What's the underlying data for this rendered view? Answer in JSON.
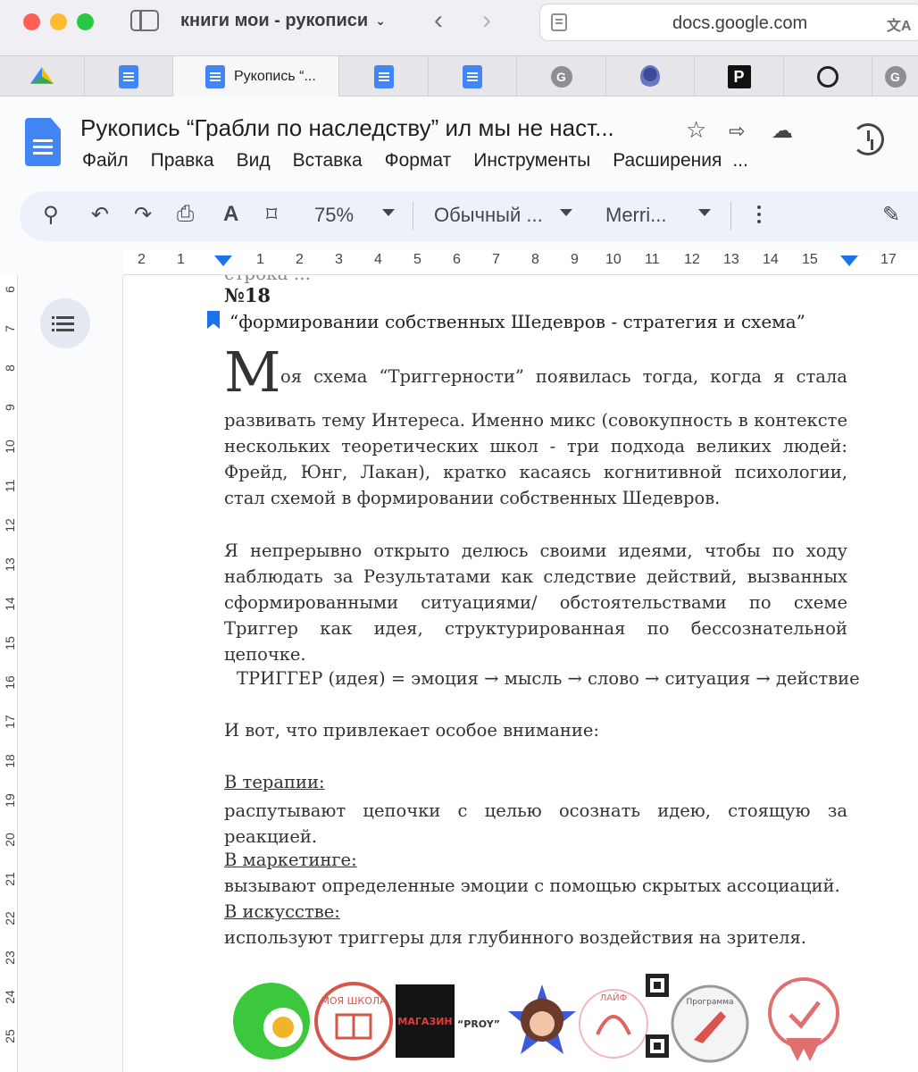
{
  "browser": {
    "window_title": "книги мои - рукописи",
    "url": "docs.google.com",
    "tabs": [
      {
        "icon": "google-drive-icon"
      },
      {
        "icon": "google-docs-icon"
      },
      {
        "icon": "google-docs-icon",
        "label": "Рукопись “...",
        "active": true
      },
      {
        "icon": "google-docs-icon"
      },
      {
        "icon": "google-docs-icon"
      },
      {
        "icon": "grammarly-icon",
        "letter": "G"
      },
      {
        "icon": "lion-icon"
      },
      {
        "icon": "p-icon",
        "letter": "P"
      },
      {
        "icon": "openai-icon"
      },
      {
        "icon": "grammarly-icon",
        "letter": "G"
      }
    ]
  },
  "docs": {
    "title": "Рукопись “Грабли по наследству” ил мы не наст...",
    "menu": [
      "Файл",
      "Правка",
      "Вид",
      "Вставка",
      "Формат",
      "Инструменты",
      "Расширения",
      "..."
    ],
    "toolbar": {
      "zoom": "75%",
      "style": "Обычный ...",
      "font": "Merri..."
    }
  },
  "ruler": {
    "h_numbers": [
      "2",
      "1",
      "1",
      "2",
      "3",
      "4",
      "5",
      "6",
      "7",
      "8",
      "9",
      "10",
      "11",
      "12",
      "13",
      "14",
      "15",
      "16",
      "17"
    ],
    "v_numbers": [
      "6",
      "7",
      "8",
      "9",
      "10",
      "11",
      "12",
      "13",
      "14",
      "15",
      "16",
      "17",
      "18",
      "19",
      "20",
      "21",
      "22",
      "23",
      "24",
      "25"
    ]
  },
  "content": {
    "cut_line": "строка ...",
    "chapter_number": "№18",
    "chapter_title": "“формировании собственных Шедевров - стратегия и схема”",
    "dropcap": "М",
    "first_line_words": [
      "оя",
      "схема",
      "“Триггерности”",
      "появилась",
      "тогда,",
      "когда",
      "я",
      "стала"
    ],
    "para1": "развивать тему Интереса. Именно микс (совокупность в контексте нескольких теоретических школ - три подхода великих людей: Фрейд, Юнг, Лакан), кратко касаясь когнитивной психологии, стал схемой в формировании собственных Шедевров.",
    "para2": "Я непрерывно открыто делюсь своими идеями, чтобы по ходу наблюдать за Результатами как следствие действий, вызванных сформированными ситуациями/ обстоятельствами по схеме Триггер как идея, структурированная по бессознательной цепочке.",
    "formula": "ТРИГГЕР (идея) = эмоция → мысль → слово → ситуация → действие",
    "attention": "И вот, что привлекает особое внимание:",
    "therapy_heading": "В терапии:",
    "therapy_text": "распутывают цепочки с целью осознать идею, стоящую за реакцией.",
    "marketing_heading": "В маркетинге:",
    "marketing_text": "вызывают определенные эмоции с помощью скрытых ассоциаций.",
    "art_heading": "В искусстве:",
    "art_text": "используют триггеры для глубинного воздействия на зрителя."
  },
  "logos": {
    "school": "МОЯ ШКОЛА",
    "shop": "МАГАЗИН",
    "shop_brand": "“PROY”",
    "life": "ЛАЙФ",
    "program": "Программа",
    "marks": "Знаки"
  },
  "colors": {
    "accent": "#1a73e8",
    "docs_blue": "#4285f4",
    "toolbar_bg": "#edf2fa"
  }
}
